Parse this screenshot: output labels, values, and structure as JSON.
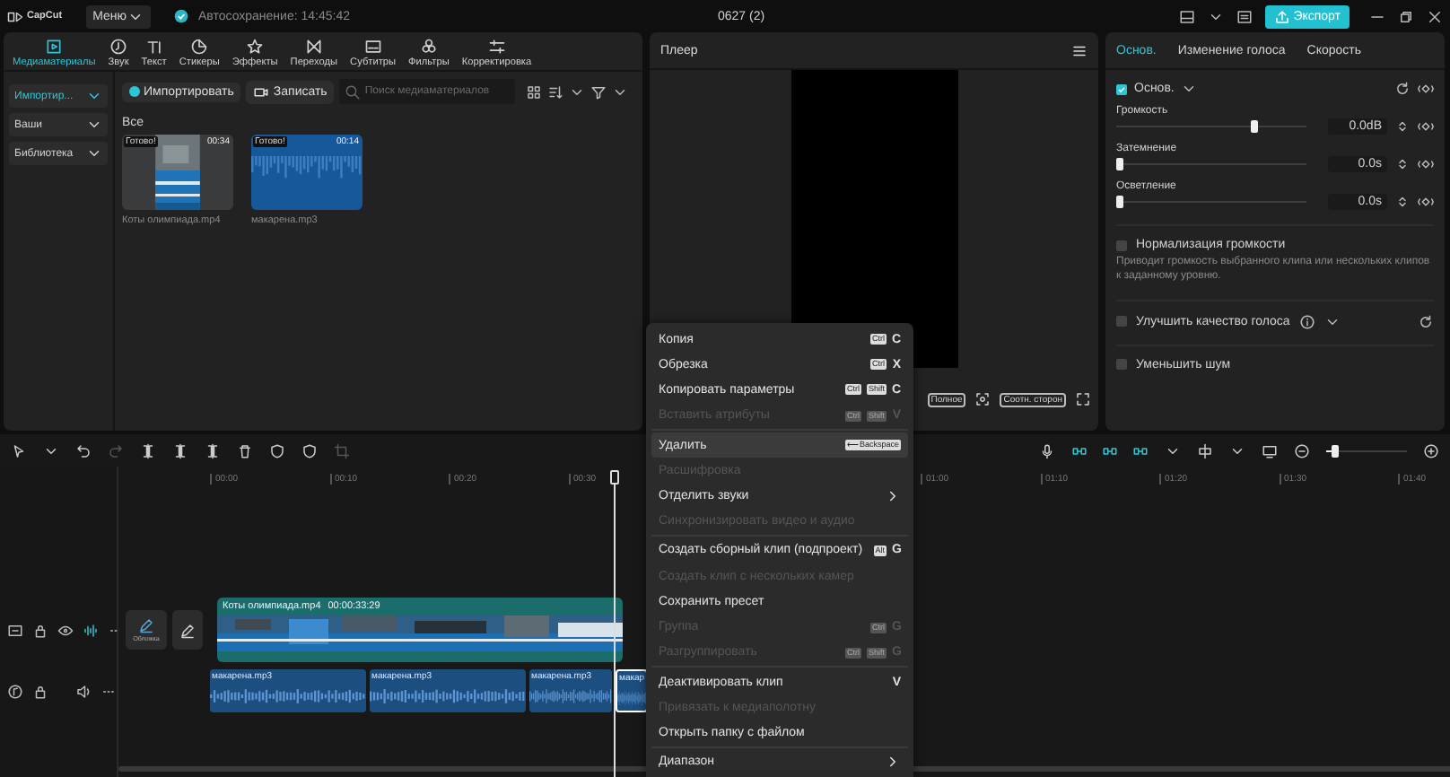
{
  "app": {
    "logo": "CapCut",
    "menu": "Меню",
    "autosave": "Автосохранение: 14:45:42",
    "project": "0627 (2)",
    "export": "Экспорт"
  },
  "tools": [
    {
      "label": "Медиаматериалы",
      "selected": true
    },
    {
      "label": "Звук",
      "selected": false
    },
    {
      "label": "Текст",
      "selected": false
    },
    {
      "label": "Стикеры",
      "selected": false
    },
    {
      "label": "Эффекты",
      "selected": false
    },
    {
      "label": "Переходы",
      "selected": false
    },
    {
      "label": "Субтитры",
      "selected": false
    },
    {
      "label": "Фильтры",
      "selected": false
    },
    {
      "label": "Корректировка",
      "selected": false
    }
  ],
  "media": {
    "sources": [
      {
        "label": "Импортир...",
        "selected": true
      },
      {
        "label": "Ваши",
        "selected": false
      },
      {
        "label": "Библиотека",
        "selected": false
      }
    ],
    "import": "Импортировать",
    "record": "Записать",
    "search": {
      "placeholder": "Поиск медиаматериалов"
    },
    "group": "Все",
    "items": [
      {
        "kind": "video",
        "name": "Коты олимпиада.mp4",
        "status": "Готово!",
        "duration": "00:34"
      },
      {
        "kind": "audio",
        "name": "макарена.mp3",
        "status": "Готово!",
        "duration": "00:14"
      }
    ]
  },
  "player": {
    "title": "Плеер",
    "buttons": [
      "Полное",
      "Соотн. сторон"
    ]
  },
  "inspector": {
    "tabs": [
      {
        "label": "Основ.",
        "selected": true
      },
      {
        "label": "Изменение голоса",
        "selected": false
      },
      {
        "label": "Скорость",
        "selected": false
      }
    ],
    "section": {
      "label": "Основ.",
      "checked": true
    },
    "sliders": [
      {
        "label": "Громкость",
        "level": 0.73,
        "reading": "0.0dB"
      },
      {
        "label": "Затемнение",
        "level": 0,
        "reading": "0.0s"
      },
      {
        "label": "Осветление",
        "level": 0,
        "reading": "0.0s"
      }
    ],
    "options": [
      {
        "label": "Нормализация громкости",
        "checked": false,
        "note": "Приводит громкость выбранного клипа или нескольких клипов к заданному уровню."
      },
      {
        "label": "Улучшить качество голоса",
        "checked": false
      },
      {
        "label": "Уменьшить шум",
        "checked": false
      }
    ]
  },
  "timeline": {
    "zoom": {
      "level": 0.08
    },
    "ruler_left": [
      "00:00",
      "00:10",
      "00:20",
      "00:30"
    ],
    "ruler_right": [
      "01:00",
      "01:10",
      "01:20",
      "01:30",
      "01:40"
    ],
    "cover": "Обложка",
    "video_clip": {
      "name": "Коты олимпиада.mp4",
      "duration": "00:00:33:29"
    },
    "audio_clips": [
      {
        "name": "макарена.mp3",
        "selected": false
      },
      {
        "name": "макарена.mp3",
        "selected": false
      },
      {
        "name": "макарена.mp3",
        "selected": false
      },
      {
        "name": "макар",
        "selected": true
      }
    ]
  },
  "context_menu": [
    [
      {
        "label": "Копия",
        "disabled": false,
        "selected": false,
        "submenu": false,
        "keys": [
          "Ctrl"
        ],
        "key": "C"
      },
      {
        "label": "Обрезка",
        "disabled": false,
        "selected": false,
        "submenu": false,
        "keys": [
          "Ctrl"
        ],
        "key": "X"
      },
      {
        "label": "Копировать параметры",
        "disabled": false,
        "selected": false,
        "submenu": false,
        "keys": [
          "Ctrl",
          "Shift"
        ],
        "key": "C"
      },
      {
        "label": "Вставить атрибуты",
        "disabled": true,
        "selected": false,
        "submenu": false,
        "keys": [
          "Ctrl",
          "Shift"
        ],
        "key": "V"
      }
    ],
    [
      {
        "label": "Удалить",
        "disabled": false,
        "selected": true,
        "submenu": false,
        "keys": [
          "⟵Backspace"
        ]
      },
      {
        "label": "Расшифровка",
        "disabled": true,
        "selected": false,
        "submenu": false
      },
      {
        "label": "Отделить звуки",
        "disabled": false,
        "selected": false,
        "submenu": true
      },
      {
        "label": "Синхронизировать видео и аудио",
        "disabled": true,
        "selected": false,
        "submenu": false
      }
    ],
    [
      {
        "label": "Создать сборный клип (подпроект)",
        "disabled": false,
        "selected": false,
        "submenu": false,
        "keys": [
          "Alt"
        ],
        "key": "G"
      },
      {
        "label": "Создать клип с нескольких камер",
        "disabled": true,
        "selected": false,
        "submenu": false
      },
      {
        "label": "Сохранить пресет",
        "disabled": false,
        "selected": false,
        "submenu": false
      },
      {
        "label": "Группа",
        "disabled": true,
        "selected": false,
        "submenu": false,
        "keys": [
          "Ctrl"
        ],
        "key": "G"
      },
      {
        "label": "Разгруппировать",
        "disabled": true,
        "selected": false,
        "submenu": false,
        "keys": [
          "Ctrl",
          "Shift"
        ],
        "key": "G"
      }
    ],
    [
      {
        "label": "Деактивировать клип",
        "disabled": false,
        "selected": false,
        "submenu": false,
        "key": "V"
      },
      {
        "label": "Привязать к медиаполотну",
        "disabled": true,
        "selected": false,
        "submenu": false
      },
      {
        "label": "Открыть папку с файлом",
        "disabled": false,
        "selected": false,
        "submenu": false
      }
    ],
    [
      {
        "label": "Диапазон",
        "disabled": false,
        "selected": false,
        "submenu": true
      }
    ]
  ]
}
